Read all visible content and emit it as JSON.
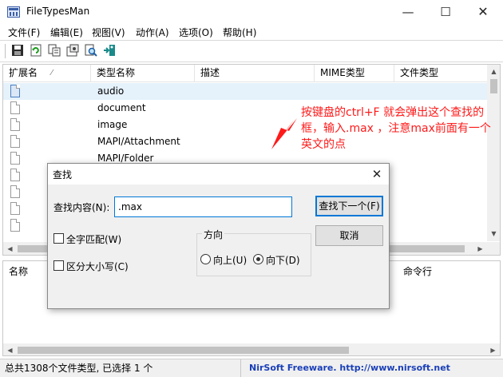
{
  "window": {
    "title": "FileTypesMan",
    "minimize_glyph": "—",
    "maximize_glyph": "☐",
    "close_glyph": "✕"
  },
  "menu": [
    "文件(F)",
    "编辑(E)",
    "视图(V)",
    "动作(A)",
    "选项(O)",
    "帮助(H)"
  ],
  "toolbar_icons": [
    "save-icon",
    "refresh-icon",
    "copy-icon",
    "properties-icon",
    "find-icon",
    "exit-icon"
  ],
  "top_list": {
    "columns": [
      "扩展名",
      "类型名称",
      "描述",
      "MIME类型",
      "文件类型"
    ],
    "sort_mark": "⁄",
    "rows": [
      "audio",
      "document",
      "image",
      "MAPI/Attachment",
      "MAPI/Folder",
      "",
      "",
      "",
      "",
      ""
    ]
  },
  "bottom_list": {
    "columns": [
      "名称",
      "命令行"
    ]
  },
  "status": {
    "left": "总共1308个文件类型, 已选择 1 个",
    "right": "NirSoft Freeware.  http://www.nirsoft.net"
  },
  "annotation": {
    "text": "按键盘的ctrl+F 就会弹出这个查找的框，输入.max ，注意max前面有一个英文的点",
    "color": "#ff1a1a"
  },
  "find_dialog": {
    "title": "查找",
    "find_label": "查找内容(N):",
    "find_value": ".max",
    "find_next_button": "查找下一个(F)",
    "cancel_button": "取消",
    "whole_word_label": "全字匹配(W)",
    "whole_word_checked": false,
    "match_case_label": "区分大小写(C)",
    "match_case_checked": false,
    "direction_label": "方向",
    "up_label": "向上(U)",
    "down_label": "向下(D)",
    "direction_selected": "down"
  },
  "colors": {
    "selection": "#e5f1fb",
    "accent": "#0078d7",
    "link": "#1a3fb8"
  }
}
